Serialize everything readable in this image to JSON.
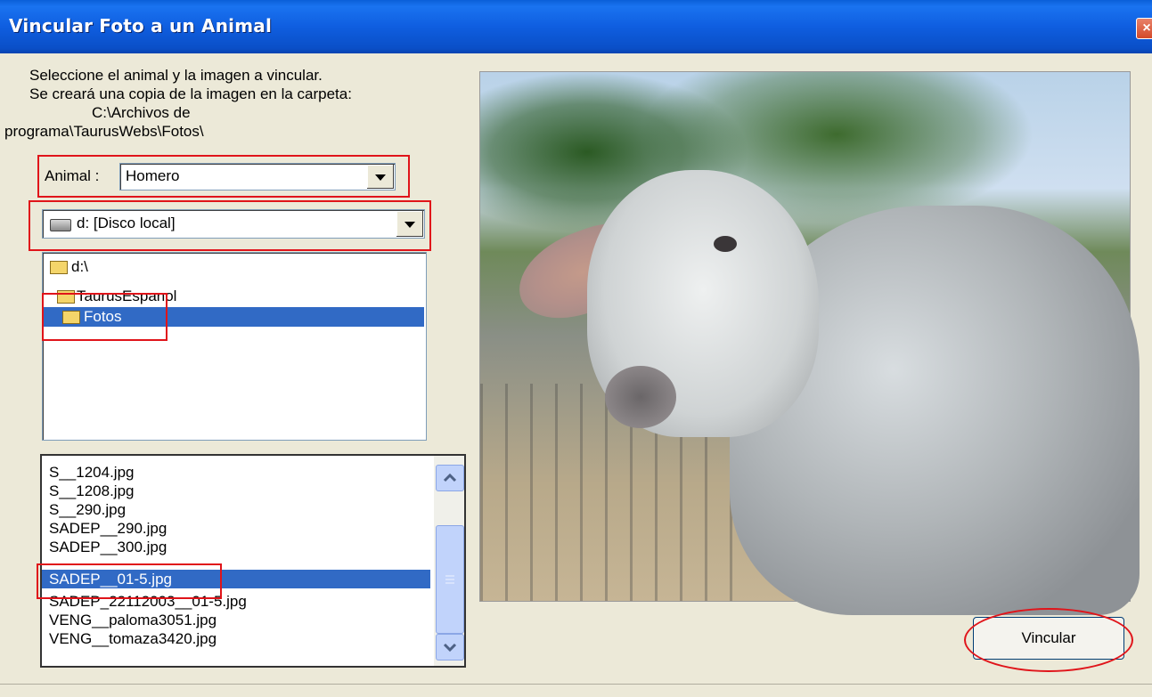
{
  "window": {
    "title": "Vincular Foto a un Animal",
    "close_glyph": "×"
  },
  "instructions": {
    "line1": "Seleccione el animal y la imagen a vincular.",
    "line2": "Se creará una copia de la imagen en la carpeta:",
    "path_line1": "C:\\Archivos de",
    "path_line2": "programa\\TaurusWebs\\Fotos\\"
  },
  "animal": {
    "label": "Animal :",
    "selected": "Homero"
  },
  "drive": {
    "selected": "d: [Disco local]",
    "icon": "drive-icon"
  },
  "directories": [
    {
      "label": "d:\\",
      "selected": false
    },
    {
      "label": "TaurusEspanol",
      "selected": false
    },
    {
      "label": "Fotos",
      "selected": true
    }
  ],
  "files": [
    {
      "label": "S__1204.jpg",
      "selected": false
    },
    {
      "label": "S__1208.jpg",
      "selected": false
    },
    {
      "label": "S__290.jpg",
      "selected": false
    },
    {
      "label": "SADEP__290.jpg",
      "selected": false
    },
    {
      "label": "SADEP__300.jpg",
      "selected": false
    },
    {
      "label": "SADEP__01-5.jpg",
      "selected": true
    },
    {
      "label": "SADEP_22112003__01-5.jpg",
      "selected": false
    },
    {
      "label": "VENG__paloma3051.jpg",
      "selected": false
    },
    {
      "label": "VENG__tomaza3420.jpg",
      "selected": false
    }
  ],
  "scroll_position": 0.55,
  "preview": {
    "subject": "cow-photo"
  },
  "actions": {
    "link_label": "Vincular"
  },
  "colors": {
    "selection": "#316ac5",
    "highlight_marker": "#e0141a",
    "titlebar": "#0a5fd8"
  }
}
